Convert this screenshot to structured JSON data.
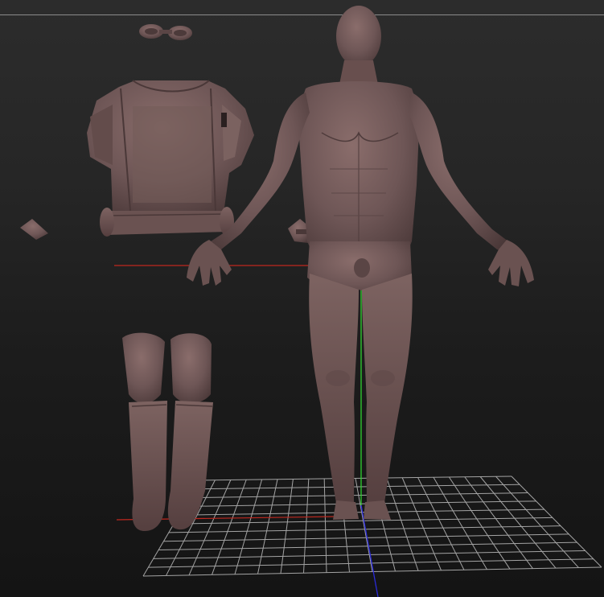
{
  "viewport": {
    "background_top": "#2c2c2c",
    "background_bottom": "#141414",
    "top_rule_color": "#8a8a8a"
  },
  "scene": {
    "objects": [
      {
        "name": "goggles"
      },
      {
        "name": "vest"
      },
      {
        "name": "wrist-guard"
      },
      {
        "name": "holster"
      },
      {
        "name": "boots"
      },
      {
        "name": "human-figure"
      }
    ],
    "material_color": "#6e5656",
    "material_shadow": "#4a3838",
    "material_highlight": "#8a6d6b",
    "floor_grid": {
      "visible": true,
      "color": "#bdbdbd"
    },
    "axes": {
      "x": {
        "color": "#c0281f"
      },
      "y": {
        "color": "#2fd32f"
      },
      "z": {
        "color": "#2a2ad8"
      }
    }
  }
}
